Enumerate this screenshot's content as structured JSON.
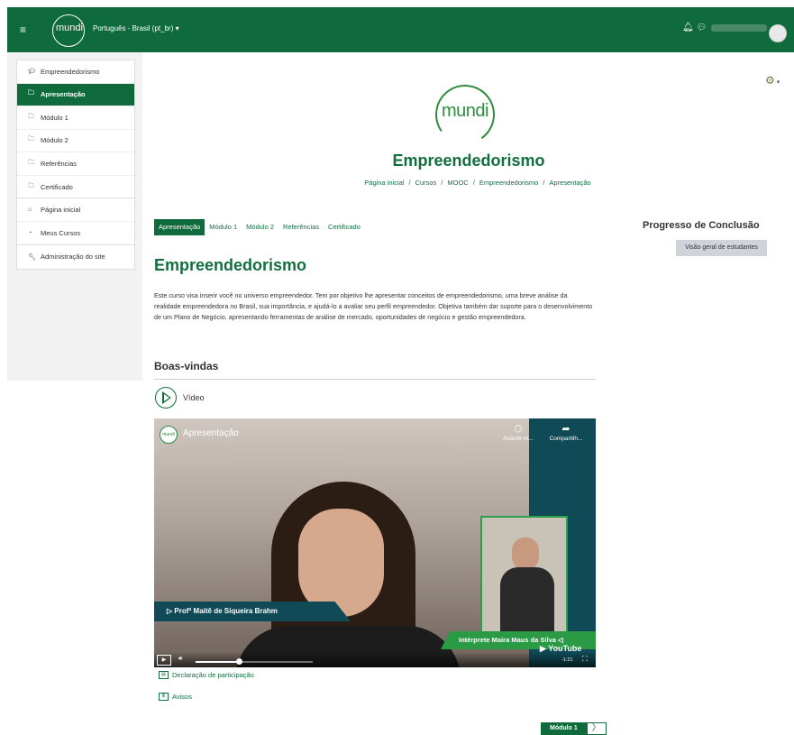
{
  "topbar": {
    "logo_text": "mundi",
    "language": "Português - Brasil (pt_br)",
    "language_caret": "▾"
  },
  "sidebar": {
    "course_items": [
      {
        "label": "Empreendedorismo",
        "icon": "graduation-cap-icon",
        "glyph": "🎓︎"
      },
      {
        "label": "Apresentação",
        "icon": "folder-icon",
        "glyph": "🗀"
      },
      {
        "label": "Módulo 1",
        "icon": "folder-icon",
        "glyph": "🗀"
      },
      {
        "label": "Módulo 2",
        "icon": "folder-icon",
        "glyph": "🗀"
      },
      {
        "label": "Referências",
        "icon": "folder-icon",
        "glyph": "🗀"
      },
      {
        "label": "Certificado",
        "icon": "folder-icon",
        "glyph": "🗀"
      }
    ],
    "site_items": [
      {
        "label": "Página inicial",
        "icon": "home-icon",
        "glyph": "⌂"
      },
      {
        "label": "Meus Cursos",
        "icon": "tachometer-icon",
        "glyph": "◔"
      }
    ],
    "admin_item": {
      "label": "Administração do site",
      "icon": "wrench-icon",
      "glyph": "🔧︎"
    }
  },
  "header": {
    "logo_text": "mundi",
    "course_title": "Empreendedorismo",
    "breadcrumb": [
      "Página inicial",
      "Cursos",
      "MOOC",
      "Empreendedorismo",
      "Apresentação"
    ],
    "breadcrumb_sep": "/"
  },
  "tabs": [
    "Apresentação",
    "Módulo 1",
    "Módulo 2",
    "Referências",
    "Certificado"
  ],
  "progress_block": {
    "title": "Progresso de Conclusão",
    "button_label": "Visão geral de estudantes"
  },
  "main": {
    "section_title": "Empreendedorismo",
    "summary": "Este curso visa inserir você no universo empreendedor. Tem por objetivo lhe apresentar conceitos de empreendedorismo, uma breve análise da realidade empreendedora no Brasil, sua importância, e ajudá-lo a avaliar seu perfil empreendedor. Objetiva também dar suporte para o desenvolvimento de um Plano de Negócio, apresentando ferramentas de análise de mercado, oportunidades de negócio e gestão empreendedora.",
    "welcome_heading": "Boas-vindas",
    "video_label": "Vídeo"
  },
  "player": {
    "channel_logo": "mundi",
    "title": "Apresentação",
    "watch_later": "Assistir m...",
    "share": "Compartilh...",
    "speaker": "▷ Profª Maitê de Siqueira Brahm",
    "interpreter": "Intérprete Maira Maus da Silva ◁",
    "brand": "▶ YouTube",
    "time": "-1:21",
    "progress_fraction": 0.37
  },
  "links": [
    {
      "label": "Declaração de participação",
      "icon": "certificate-icon"
    },
    {
      "label": "Avisos",
      "icon": "news-icon"
    }
  ],
  "next_button": {
    "label": "Módulo 1",
    "arrow": "〉"
  },
  "colors": {
    "primary": "#0f6b3c",
    "accent": "#2e8b3e",
    "interpreter_band": "#2a9a44",
    "dark_teal": "#0f4a56"
  }
}
